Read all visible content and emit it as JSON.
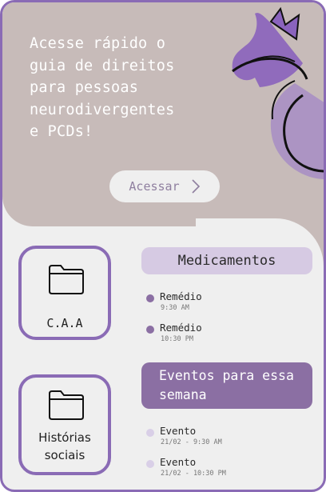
{
  "hero": {
    "text": "Acesse rápido o\nguia de direitos\npara pessoas\nneurodivergentes\ne PCDs!",
    "button_label": "Acessar",
    "button_icon": "chevron-right-icon"
  },
  "tiles": [
    {
      "label": "C.A.A",
      "icon": "folder-icon"
    },
    {
      "label": "Histórias\nsociais",
      "icon": "folder-icon"
    }
  ],
  "medications": {
    "title": "Medicamentos",
    "items": [
      {
        "name": "Remédio",
        "time": "9:30 AM"
      },
      {
        "name": "Remédio",
        "time": "10:30 PM"
      }
    ]
  },
  "events": {
    "title": "Eventos para essa semana",
    "items": [
      {
        "name": "Evento",
        "time": "21/02 - 9:30 AM"
      },
      {
        "name": "Evento",
        "time": "21/02 - 10:30 PM"
      }
    ]
  },
  "colors": {
    "accent": "#8a6bb5",
    "hero_bg": "#c7bbb9",
    "med_header": "#d6cae3",
    "event_header": "#8b6fa3"
  }
}
